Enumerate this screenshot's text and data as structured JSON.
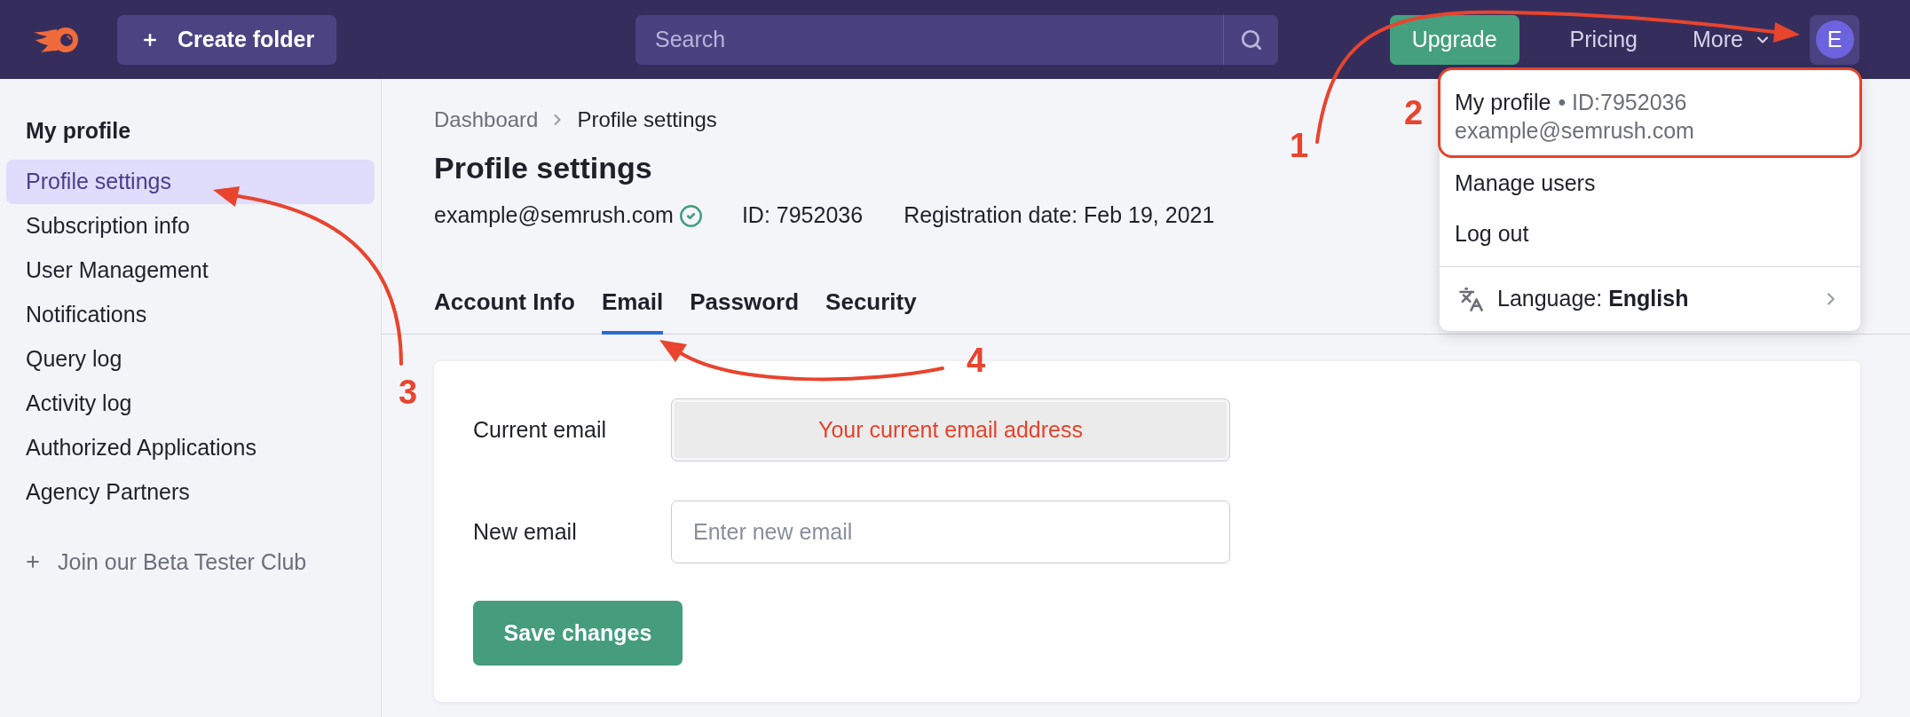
{
  "top_bar": {
    "create_button": "Create folder",
    "search": {
      "placeholder": "Search"
    },
    "upgrade_button": "Upgrade",
    "links": [
      {
        "kind": "link",
        "label": "Pricing"
      },
      {
        "kind": "dropdown",
        "label": "More"
      }
    ],
    "avatar": "E"
  },
  "sidebar": {
    "title": "My profile",
    "items": [
      {
        "label": "Profile settings",
        "selected": true
      },
      {
        "label": "Subscription info",
        "selected": false
      },
      {
        "label": "User Management",
        "selected": false
      },
      {
        "label": "Notifications",
        "selected": false
      },
      {
        "label": "Query log",
        "selected": false
      },
      {
        "label": "Activity log",
        "selected": false
      },
      {
        "label": "Authorized Applications",
        "selected": false
      },
      {
        "label": "Agency Partners",
        "selected": false
      }
    ],
    "beta_link": "Join our Beta Tester Club"
  },
  "breadcrumb": [
    "Dashboard",
    "Profile settings"
  ],
  "page_title": "Profile settings",
  "meta": {
    "email": "example@semrush.com",
    "verified": true,
    "id": "ID: 7952036",
    "registration": "Registration date: Feb 19, 2021"
  },
  "tabs": [
    {
      "label": "Account Info",
      "selected": false
    },
    {
      "label": "Email",
      "selected": true
    },
    {
      "label": "Password",
      "selected": false
    },
    {
      "label": "Security",
      "selected": false
    }
  ],
  "form": {
    "fields": [
      {
        "label": "Current email",
        "value": "Your current email address",
        "disabled": true
      },
      {
        "label": "New email",
        "placeholder": "Enter new email",
        "disabled": false
      }
    ],
    "save_button": "Save changes"
  },
  "account_menu": {
    "items": [
      {
        "kind": "profile",
        "title": "My profile",
        "detail": "• ID:7952036",
        "subtitle": "example@semrush.com",
        "highlighted": true
      },
      {
        "kind": "link",
        "label": "Manage users"
      },
      {
        "kind": "link",
        "label": "Log out"
      },
      {
        "kind": "language",
        "label": "Language: **English**"
      }
    ]
  },
  "annotations": [
    {
      "label": "1"
    },
    {
      "label": "2"
    },
    {
      "label": "3"
    },
    {
      "label": "4"
    }
  ]
}
